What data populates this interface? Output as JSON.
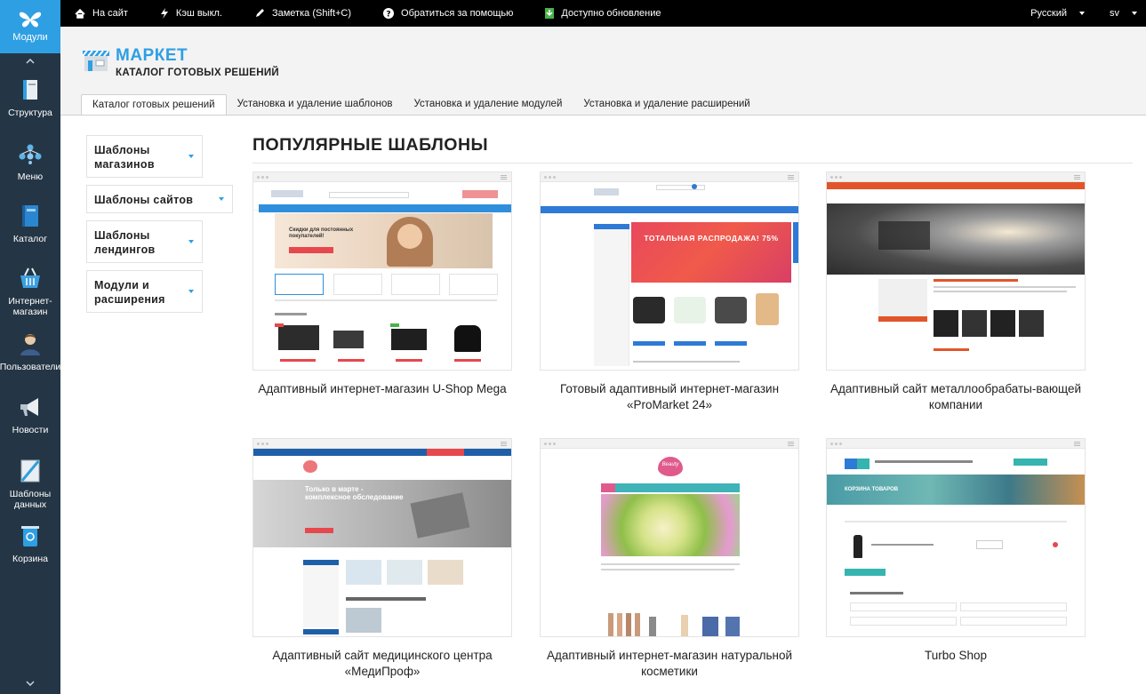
{
  "sidebar": {
    "top_label": "Модули",
    "items": [
      {
        "label": "Структура",
        "icon": "structure-icon"
      },
      {
        "label": "Меню",
        "icon": "menu-icon"
      },
      {
        "label": "Каталог",
        "icon": "catalog-book-icon"
      },
      {
        "label": "Интернет-\nмагазин",
        "icon": "shop-basket-icon"
      },
      {
        "label": "Пользователи",
        "icon": "users-icon"
      },
      {
        "label": "Новости",
        "icon": "megaphone-icon"
      },
      {
        "label": "Шаблоны\nданных",
        "icon": "data-templates-icon"
      },
      {
        "label": "Корзина",
        "icon": "recycle-bin-icon"
      }
    ]
  },
  "topbar": {
    "items": [
      {
        "label": "На сайт",
        "icon": "home-icon"
      },
      {
        "label": "Кэш выкл.",
        "icon": "lightning-icon"
      },
      {
        "label": "Заметка (Shift+C)",
        "icon": "pen-icon"
      },
      {
        "label": "Обратиться за помощью",
        "icon": "help-icon"
      },
      {
        "label": "Доступно обновление",
        "icon": "download-icon"
      }
    ],
    "language": "Русский",
    "user": "sv"
  },
  "header": {
    "title": "МАРКЕТ",
    "subtitle": "КАТАЛОГ ГОТОВЫХ РЕШЕНИЙ"
  },
  "tabs": [
    {
      "label": "Каталог готовых решений",
      "active": true
    },
    {
      "label": "Установка и удаление шаблонов",
      "active": false
    },
    {
      "label": "Установка и удаление модулей",
      "active": false
    },
    {
      "label": "Установка и удаление расширений",
      "active": false
    }
  ],
  "categories": [
    {
      "label": "Шаблоны магазинов"
    },
    {
      "label": "Шаблоны сайтов"
    },
    {
      "label": "Шаблоны лендингов"
    },
    {
      "label": "Модули и расширения"
    }
  ],
  "section_title": "ПОПУЛЯРНЫЕ ШАБЛОНЫ",
  "templates": [
    {
      "title": "Адаптивный интернет-магазин U-Shop Mega",
      "preview_text": "Скидки для постоянных покупателей!",
      "accent": "#2f8fdc"
    },
    {
      "title": "Готовый адаптивный интернет-магазин «ProMarket 24»",
      "preview_text": "ТОТАЛЬНАЯ РАСПРОДАЖА! 75%",
      "accent": "#2e7ad6"
    },
    {
      "title": "Адаптивный сайт металлообрабаты-вающей компании",
      "preview_text": "",
      "accent": "#e2552a"
    },
    {
      "title": "Адаптивный сайт медицинского центра «МедиПроф»",
      "preview_text": "Только в марте - комплексное обследование",
      "accent": "#1e5fa8"
    },
    {
      "title": "Адаптивный интернет-магазин натуральной косметики",
      "preview_text": "Beauty",
      "accent": "#e05a8c"
    },
    {
      "title": "Turbo Shop",
      "preview_text": "КОРЗИНА ТОВАРОВ",
      "accent": "#36b4b0"
    }
  ],
  "colors": {
    "sidebar_bg": "#243645",
    "accent_blue": "#2e9fe3",
    "topbar_bg": "#000000"
  }
}
